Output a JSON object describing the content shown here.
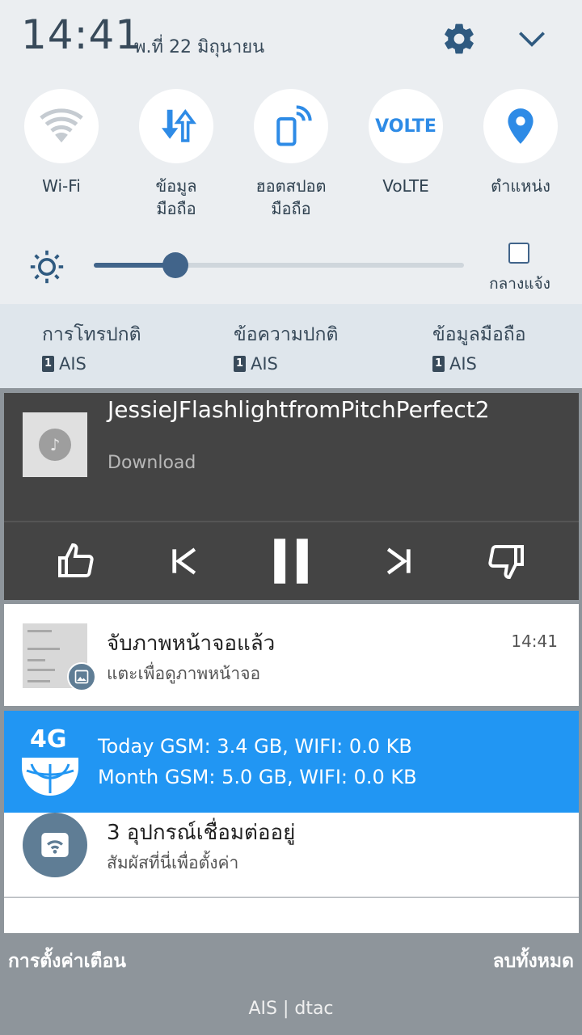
{
  "header": {
    "time": "14:41",
    "date": "พ.ที่ 22 มิถุนายน",
    "icons": [
      "gear-icon",
      "chevron-down-icon"
    ]
  },
  "quick_toggles": [
    {
      "id": "wifi",
      "label": "Wi-Fi",
      "icon": "wifi-icon"
    },
    {
      "id": "mobile-data",
      "label": "ข้อมูล\nมือถือ",
      "icon": "data-arrows-icon"
    },
    {
      "id": "hotspot",
      "label": "ฮอตสปอต\nมือถือ",
      "icon": "hotspot-icon"
    },
    {
      "id": "volte",
      "label": "VoLTE",
      "icon_text": "VOLTE"
    },
    {
      "id": "location",
      "label": "ตำแหน่ง",
      "icon": "location-pin-icon"
    }
  ],
  "brightness": {
    "level": 0.22,
    "auto_label": "กลางแจ้ง"
  },
  "sim_bar": [
    {
      "title": "การโทรปกติ",
      "sim": "1",
      "carrier": "AIS"
    },
    {
      "title": "ข้อความปกติ",
      "sim": "1",
      "carrier": "AIS"
    },
    {
      "title": "ข้อมูลมือถือ",
      "sim": "1",
      "carrier": "AIS"
    }
  ],
  "media": {
    "title": "JessieJFlashlightfromPitchPerfect2",
    "subtitle": "Download",
    "art_icon": "music-note-icon"
  },
  "screenshot_notif": {
    "title": "จับภาพหน้าจอแล้ว",
    "text": "แตะเพื่อดูภาพหน้าจอ",
    "time": "14:41"
  },
  "data_notif": {
    "badge": "4G",
    "line1": "Today GSM: 3.4 GB, WIFI: 0.0 KB",
    "line2": "Month GSM: 5.0 GB, WIFI: 0.0 KB"
  },
  "hotspot_notif": {
    "title": "3 อุปกรณ์เชื่อมต่ออยู่",
    "text": "สัมผัสที่นี่เพื่อตั้งค่า"
  },
  "bottom_bar": {
    "left": "การตั้งค่าเตือน",
    "right": "ลบทั้งหมด",
    "carrier": "AIS | dtac"
  },
  "colors": {
    "accent": "#2196f3",
    "panel": "#ebeef1",
    "slider": "#41648a"
  }
}
